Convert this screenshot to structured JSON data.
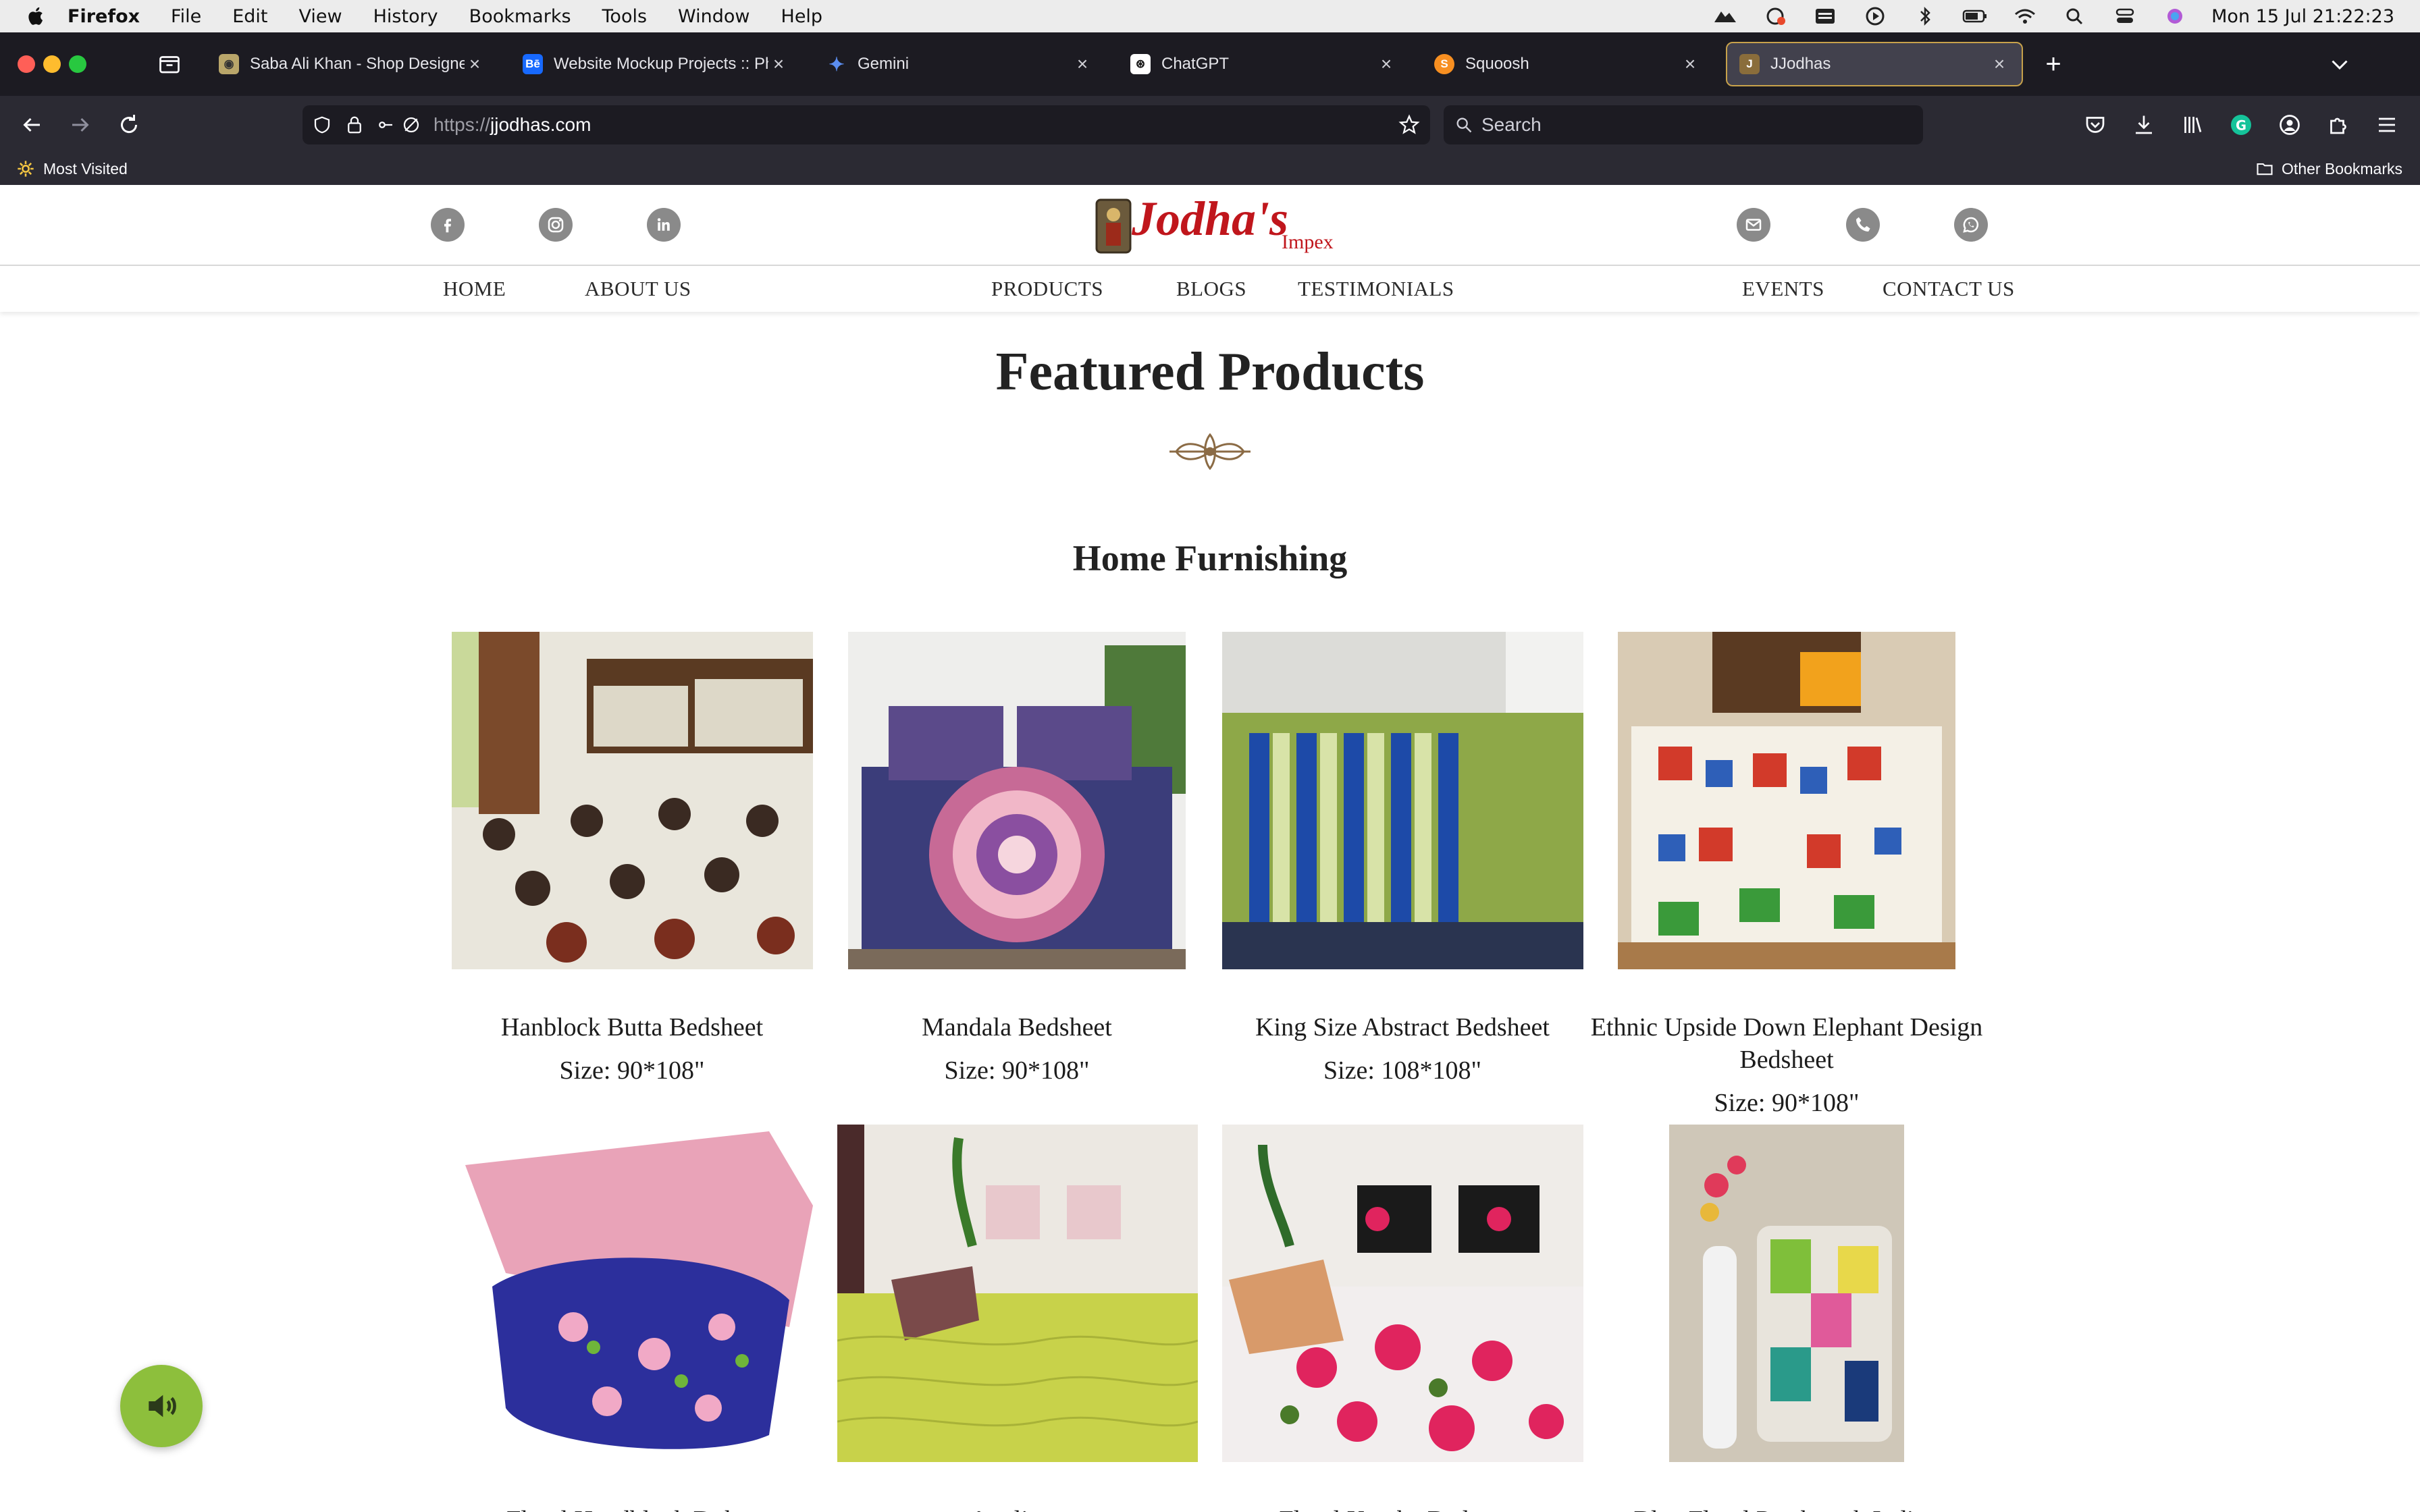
{
  "menubar": {
    "app": "Firefox",
    "items": [
      "File",
      "Edit",
      "View",
      "History",
      "Bookmarks",
      "Tools",
      "Window",
      "Help"
    ],
    "clock": "Mon 15 Jul  21:22:23"
  },
  "tabs": [
    {
      "title": "Saba Ali Khan - Shop Designers",
      "favicon": "globe-icon",
      "active": false
    },
    {
      "title": "Website Mockup Projects :: Pho",
      "favicon": "behance-icon",
      "active": false
    },
    {
      "title": "Gemini",
      "favicon": "gemini-icon",
      "active": false
    },
    {
      "title": "ChatGPT",
      "favicon": "chatgpt-icon",
      "active": false
    },
    {
      "title": "Squoosh",
      "favicon": "squoosh-icon",
      "active": false
    },
    {
      "title": "JJodhas",
      "favicon": "jodhas-icon",
      "active": true
    }
  ],
  "navbar": {
    "url_scheme": "https://",
    "url_host": "jjodhas.com",
    "search_placeholder": "Search"
  },
  "bookmarks": {
    "most_visited": "Most Visited",
    "other": "Other Bookmarks"
  },
  "site": {
    "logo_text": "Jodha's",
    "logo_sub": "Impex",
    "nav": [
      "HOME",
      "ABOUT US",
      "PRODUCTS",
      "BLOGS",
      "TESTIMONIALS",
      "EVENTS",
      "CONTACT US"
    ],
    "featured_title": "Featured Products",
    "category_title": "Home Furnishing",
    "products": [
      {
        "name": "Hanblock Butta Bedsheet",
        "size": "Size: 90*108\""
      },
      {
        "name": "Mandala Bedsheet",
        "size": "Size: 90*108\""
      },
      {
        "name": "King Size Abstract Bedsheet",
        "size": "Size: 108*108\""
      },
      {
        "name": "Ethnic Upside Down Elephant Design Bedsheet",
        "size": "Size: 90*108\""
      },
      {
        "name": "Floral Handblock Dohar",
        "size": ""
      },
      {
        "name": "Applique",
        "size": ""
      },
      {
        "name": "Floral Kantha Bedcover",
        "size": ""
      },
      {
        "name": "Blue Floral Patchwork Indigo",
        "size": ""
      }
    ]
  },
  "colors": {
    "chrome_bg": "#1c1b22",
    "toolbar_bg": "#2b2a33",
    "active_tab_border": "#c8a24b",
    "logo_red": "#c0161c",
    "sound_button": "#8dbf3c"
  }
}
